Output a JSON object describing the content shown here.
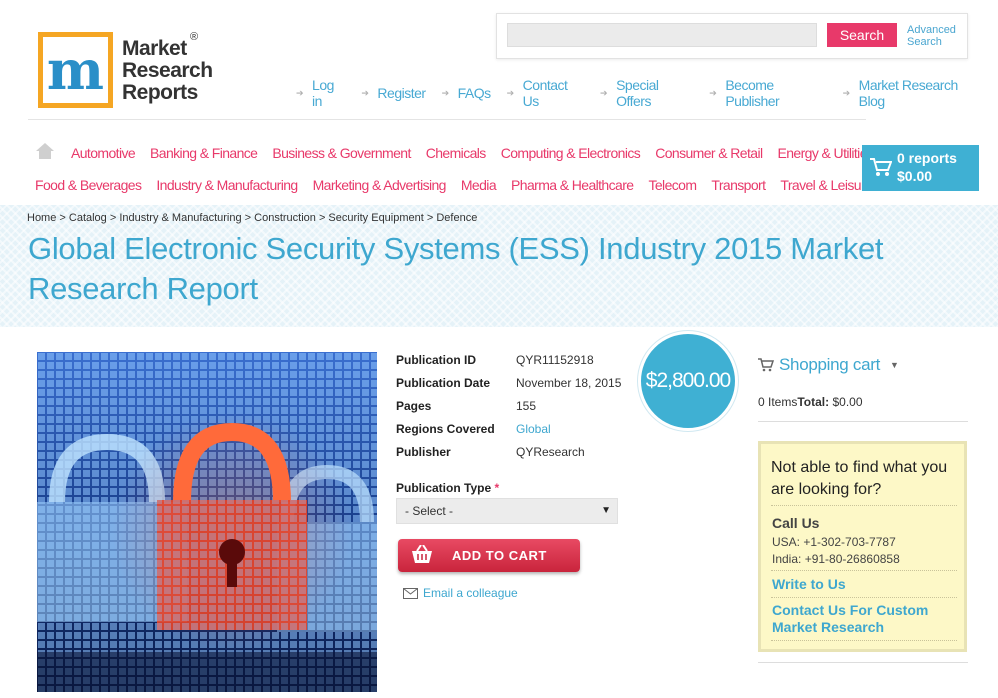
{
  "logo": {
    "line1": "Market",
    "line2": "Research",
    "line3": "Reports",
    "reg": "®"
  },
  "search": {
    "placeholder": "",
    "button": "Search",
    "advanced_line1": "Advanced",
    "advanced_line2": "Search"
  },
  "topnav": [
    "Log in",
    "Register",
    "FAQs",
    "Contact Us",
    "Special Offers",
    "Become Publisher",
    "Market Research Blog"
  ],
  "categories_row1": [
    "Automotive",
    "Banking & Finance",
    "Business & Government",
    "Chemicals",
    "Computing & Electronics",
    "Consumer & Retail",
    "Energy & Utilities"
  ],
  "categories_row2": [
    "Food & Beverages",
    "Industry & Manufacturing",
    "Marketing & Advertising",
    "Media",
    "Pharma & Healthcare",
    "Telecom",
    "Transport",
    "Travel & Leisure"
  ],
  "header_cart": {
    "reports": "0 reports",
    "total": "$0.00"
  },
  "breadcrumb": "Home > Catalog > Industry & Manufacturing > Construction > Security Equipment > Defence",
  "title": "Global Electronic Security Systems (ESS) Industry 2015 Market Research Report",
  "details": {
    "pub_id_label": "Publication ID",
    "pub_id": "QYR11152918",
    "pub_date_label": "Publication Date",
    "pub_date": "November 18, 2015",
    "pages_label": "Pages",
    "pages": "155",
    "regions_label": "Regions Covered",
    "regions": "Global",
    "publisher_label": "Publisher",
    "publisher": "QYResearch"
  },
  "price": "$2,800.00",
  "purchase": {
    "type_label": "Publication Type",
    "required_mark": "*",
    "select_value": "- Select -",
    "add_to_cart": "ADD TO CART",
    "email": "Email a colleague"
  },
  "sidebar": {
    "cart_title": "Shopping cart",
    "items": "0 Items",
    "total_label": "Total:",
    "total_value": "$0.00",
    "help_question": "Not able to find what you are looking for?",
    "call_us": "Call Us",
    "phone_usa": "USA: +1-302-703-7787",
    "phone_india": "India: +91-80-26860858",
    "write_to_us": "Write to Us",
    "custom_research": "Contact Us For Custom Market Research"
  },
  "colors": {
    "accent_blue": "#3ea7cf",
    "accent_pink": "#e8396a",
    "logo_orange": "#f5a623"
  }
}
